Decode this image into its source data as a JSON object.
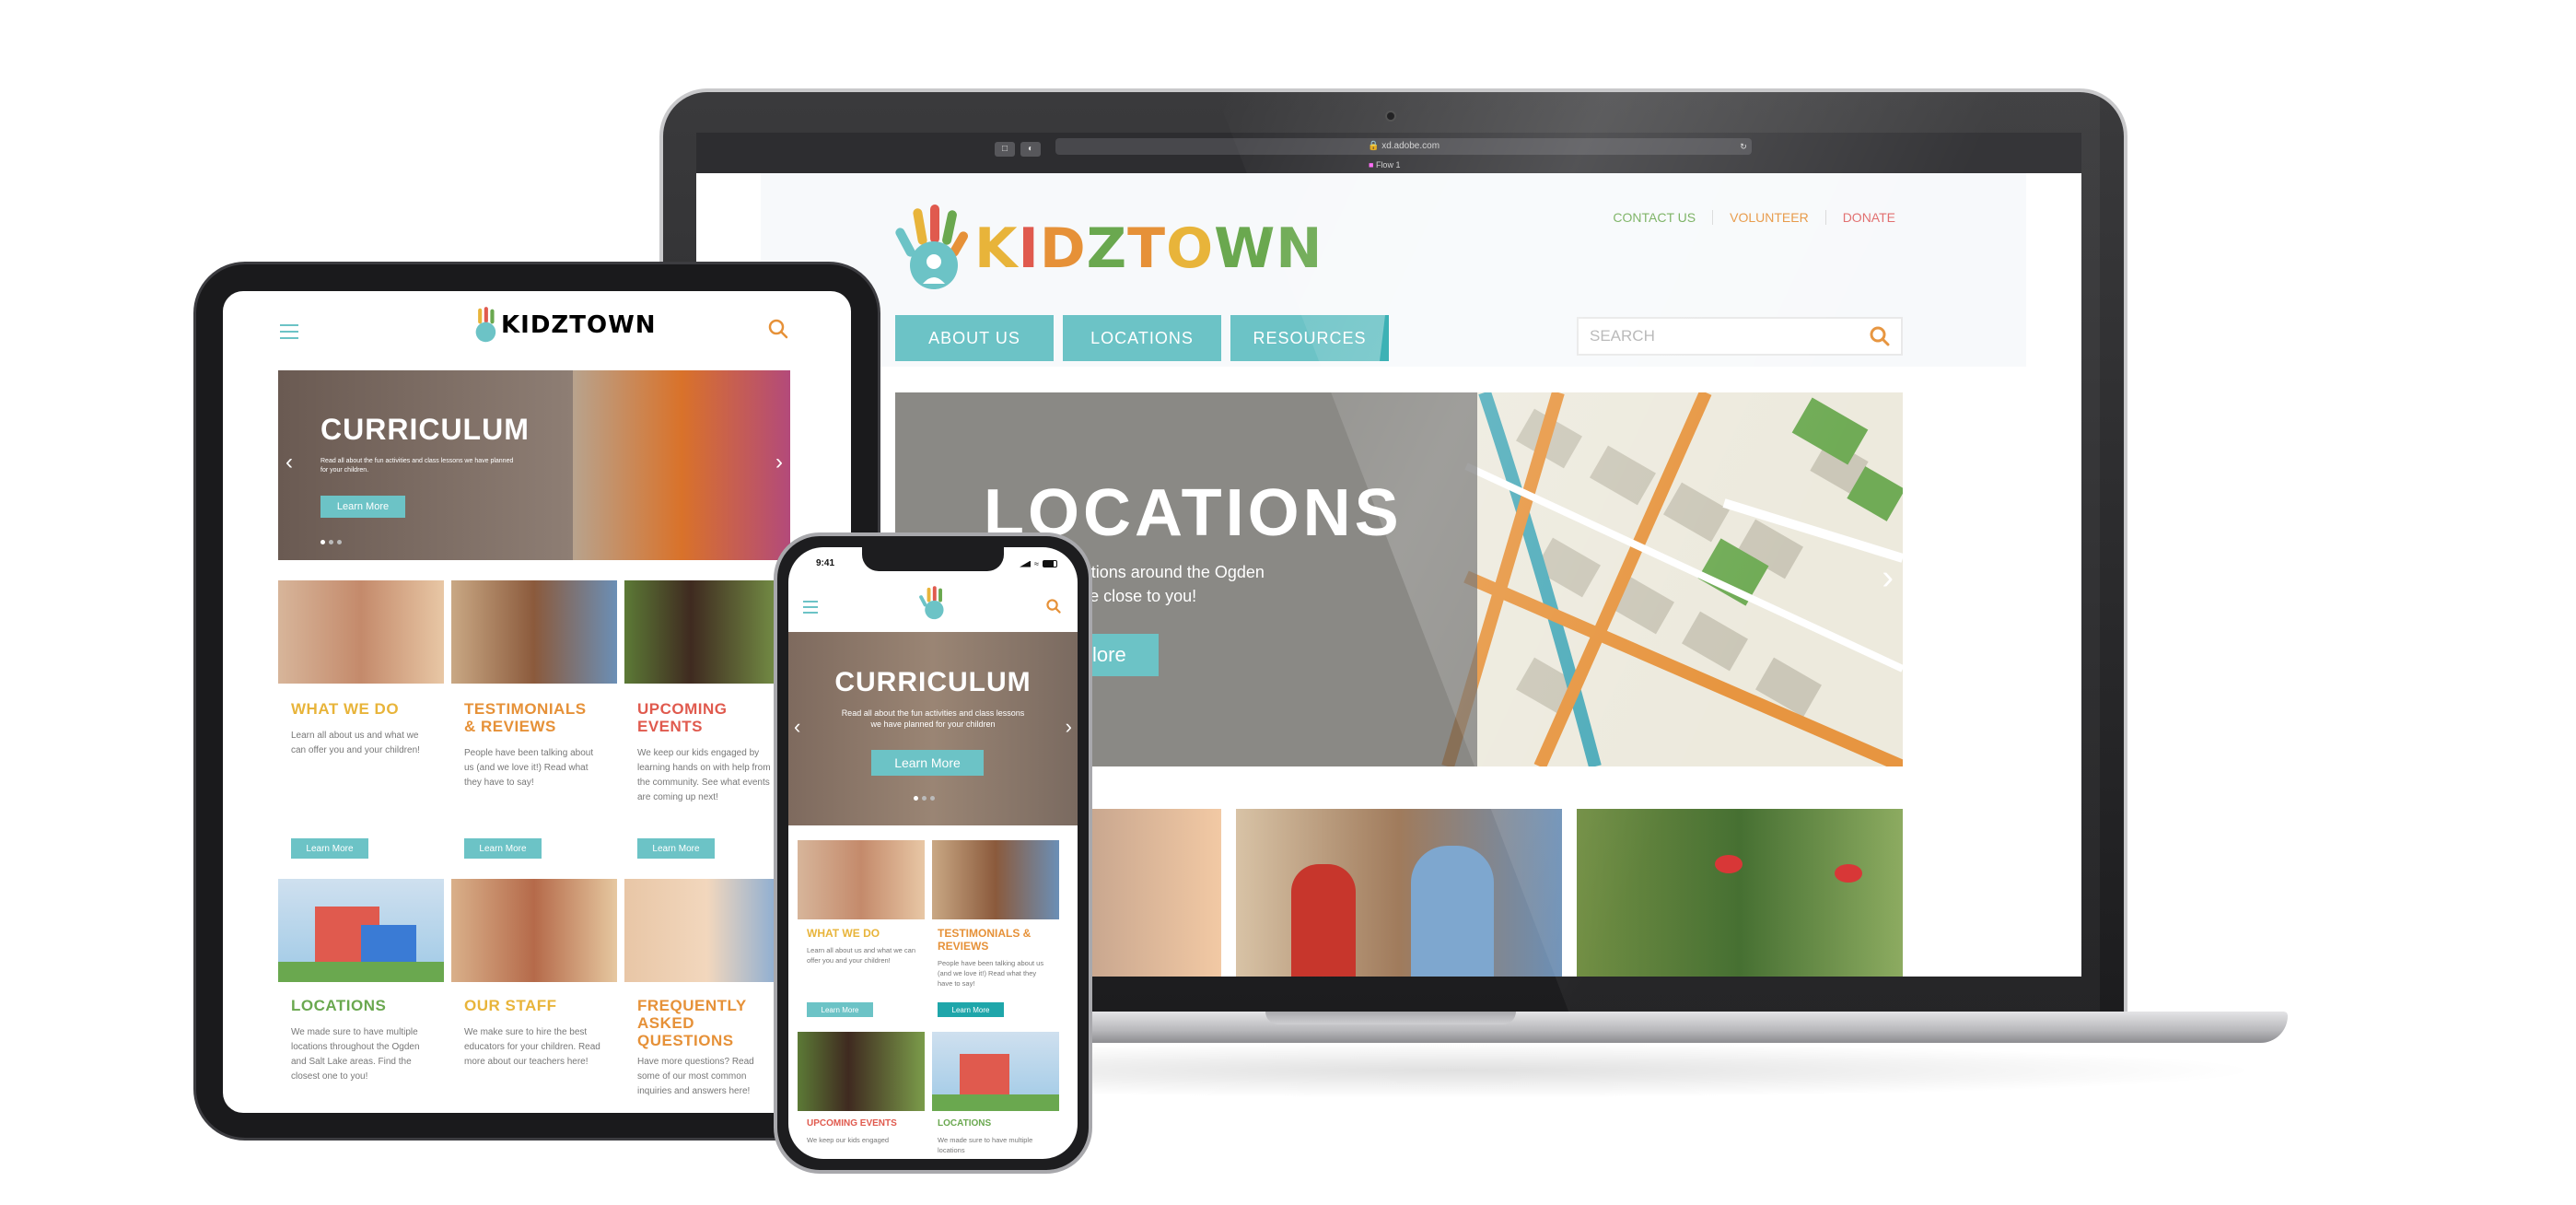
{
  "browser": {
    "url": "xd.adobe.com",
    "tab_title": "Flow 1"
  },
  "site": {
    "logo_text": "KIDZTOWN",
    "top_links": [
      "CONTACT US",
      "VOLUNTEER",
      "DONATE"
    ],
    "top_link_colors": [
      "#6aa84f",
      "#e69138",
      "#e06666"
    ],
    "nav": [
      "ABOUT US",
      "LOCATIONS",
      "RESOURCES"
    ],
    "search_placeholder": "SEARCH",
    "hero": {
      "title": "LOCATIONS",
      "text_line1": "v different locations around the Ogden",
      "text_line2": "areas. Find one close to you!",
      "button": "lore"
    }
  },
  "tablet": {
    "hero": {
      "title": "CURRICULUM",
      "text": "Read all about the fun activities and class lessons we have planned for your children.",
      "button": "Learn More"
    },
    "cards": [
      {
        "title": "WHAT WE DO",
        "color": "#e8b43a",
        "text": "Learn all about us and what we can offer you and your children!",
        "button": "Learn More"
      },
      {
        "title": "TESTIMONIALS & REVIEWS",
        "color": "#e69138",
        "text": "People have been talking about us (and we love it!) Read what they have to say!",
        "button": "Learn More"
      },
      {
        "title": "UPCOMING EVENTS",
        "color": "#e05a4e",
        "text": "We keep our kids engaged by learning hands on with help from the community. See what events are coming up next!",
        "button": "Learn More"
      },
      {
        "title": "LOCATIONS",
        "color": "#6aa84f",
        "text": "We made sure to have multiple locations throughout the Ogden and Salt Lake areas. Find the closest one to you!"
      },
      {
        "title": "OUR STAFF",
        "color": "#e8b43a",
        "text": "We make sure to hire the best educators for your children. Read more about our teachers here!"
      },
      {
        "title": "FREQUENTLY ASKED QUESTIONS",
        "color": "#e69138",
        "text": "Have more questions? Read some of our most common inquiries and answers here!"
      }
    ]
  },
  "phone": {
    "time": "9:41",
    "hero": {
      "title": "CURRICULUM",
      "text_line1": "Read all about the fun activities and class lessons",
      "text_line2": "we have planned for your children",
      "button": "Learn More"
    },
    "cards": [
      {
        "title": "WHAT WE DO",
        "color": "#e8b43a",
        "text": "Learn all about us and what we can offer you and your children!",
        "button": "Learn More"
      },
      {
        "title": "TESTIMONIALS & REVIEWS",
        "color": "#e69138",
        "text": "People have been talking about us (and we love it!) Read what they have to say!",
        "button": "Learn More"
      },
      {
        "title": "UPCOMING EVENTS",
        "color": "#e05a4e",
        "text": "We keep our kids engaged"
      },
      {
        "title": "LOCATIONS",
        "color": "#6aa84f",
        "text": "We made sure to have multiple locations"
      }
    ]
  },
  "colors": {
    "teal": "#6cc3c6",
    "teal_dark": "#1fa6aa",
    "orange": "#e69138",
    "yellow": "#e8b43a",
    "red": "#e05a4e",
    "green": "#6aa84f"
  },
  "icons": [
    "hand-logo-icon",
    "search-icon",
    "menu-icon",
    "chevron-left-icon",
    "chevron-right-icon",
    "camera-icon",
    "battery-icon",
    "wifi-icon",
    "signal-icon"
  ]
}
